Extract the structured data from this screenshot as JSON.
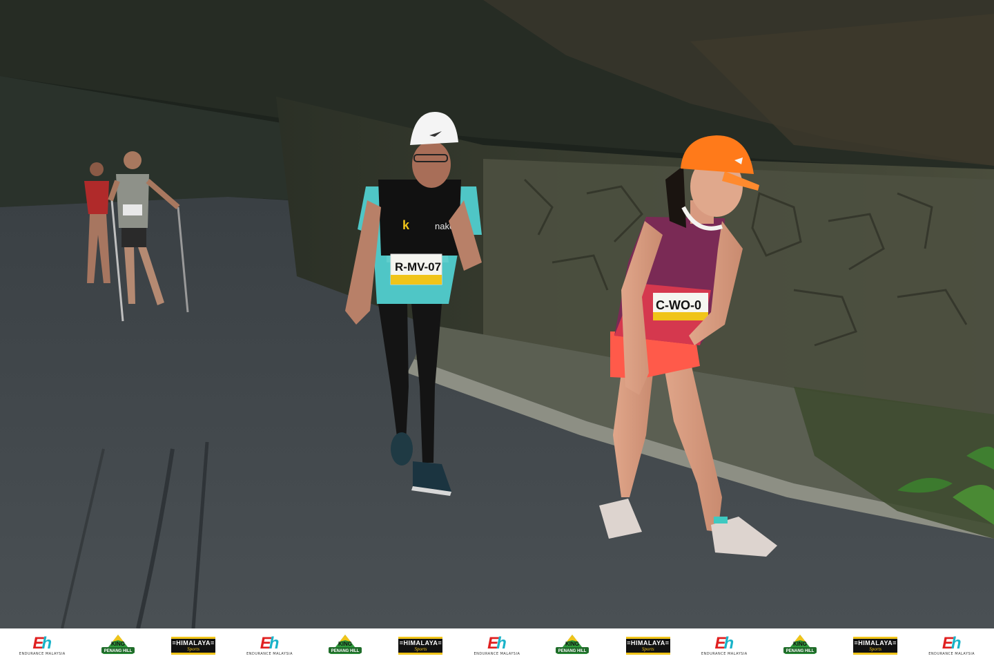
{
  "photo": {
    "runners": [
      {
        "bib": "R-MV-07",
        "cap_color": "#f4f4f4",
        "top_color": "#4fc6c6"
      },
      {
        "bib": "C-WO-0",
        "cap_color": "#ff7a1a",
        "top_color": "#7a2a55"
      }
    ],
    "vest_brand": "k",
    "vest_text": "nake"
  },
  "sponsor_strip": {
    "logos": [
      {
        "type": "eh",
        "icon": "endurance-malaysia-logo",
        "caption": "ENDURANCE MALAYSIA"
      },
      {
        "type": "king",
        "icon": "king-of-penang-hill-logo",
        "line1": "KING",
        "line2": "PENANG HILL"
      },
      {
        "type": "himalaya",
        "icon": "himalaya-sports-logo",
        "line1": "=HIMALAYA=",
        "line2": "Sports"
      },
      {
        "type": "eh",
        "icon": "endurance-malaysia-logo",
        "caption": "ENDURANCE MALAYSIA"
      },
      {
        "type": "king",
        "icon": "king-of-penang-hill-logo",
        "line1": "KING",
        "line2": "PENANG HILL"
      },
      {
        "type": "himalaya",
        "icon": "himalaya-sports-logo",
        "line1": "=HIMALAYA=",
        "line2": "Sports"
      },
      {
        "type": "eh",
        "icon": "endurance-malaysia-logo",
        "caption": "ENDURANCE MALAYSIA"
      },
      {
        "type": "king",
        "icon": "king-of-penang-hill-logo",
        "line1": "KING",
        "line2": "PENANG HILL"
      },
      {
        "type": "himalaya",
        "icon": "himalaya-sports-logo",
        "line1": "=HIMALAYA=",
        "line2": "Sports"
      },
      {
        "type": "eh",
        "icon": "endurance-malaysia-logo",
        "caption": "ENDURANCE MALAYSIA"
      },
      {
        "type": "king",
        "icon": "king-of-penang-hill-logo",
        "line1": "KING",
        "line2": "PENANG HILL"
      },
      {
        "type": "himalaya",
        "icon": "himalaya-sports-logo",
        "line1": "=HIMALAYA=",
        "line2": "Sports"
      },
      {
        "type": "eh",
        "icon": "endurance-malaysia-logo",
        "caption": "ENDURANCE MALAYSIA"
      }
    ]
  }
}
